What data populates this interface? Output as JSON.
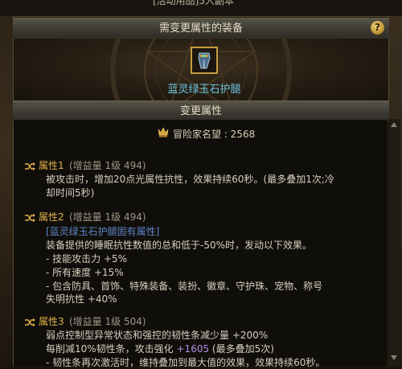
{
  "window": {
    "top_title": "[活动用品]5人副本"
  },
  "equip_section": {
    "title": "需变更属性的装备",
    "item_name": "蓝灵绿玉石护腿",
    "item_icon": "leg-armor-icon"
  },
  "change_section": {
    "title": "变更属性"
  },
  "fame": {
    "label": "冒险家名望 : 2568",
    "icon": "fame-crown-icon"
  },
  "attributes": [
    {
      "header_name": "属性1",
      "header_meta": "(增益量 1级 494)",
      "lines": [
        {
          "text": "被攻击时，增加20点光属性抗性，效果持续60秒。(最多叠加1次;冷"
        },
        {
          "text": "却时间5秒)"
        }
      ]
    },
    {
      "header_name": "属性2",
      "header_meta": "(增益量 1级 494)",
      "lines": [
        {
          "text": "[蓝灵绿玉石护腿固有属性]"
        },
        {
          "text": "装备提供的睡眠抗性数值的总和低于-50%时，发动以下效果。"
        },
        {
          "text": "- 技能攻击力 +5%"
        },
        {
          "text": "- 所有速度 +15%"
        },
        {
          "text": "- 包含防具、首饰、特殊装备、装扮、徽章、守护珠、宠物、称号"
        },
        {
          "text": "失明抗性 +40%"
        }
      ]
    },
    {
      "header_name": "属性3",
      "header_meta": "(增益量 1级 504)",
      "lines": [
        {
          "text": "弱点控制型异常状态和强控的韧性条减少量 +200%"
        },
        {
          "text_a": "每削减10%韧性条，攻击强化 ",
          "text_b": "+1605",
          "text_c": " (最多叠加5次)"
        },
        {
          "text": "- 韧性条再次激活时，维持叠加到最大值的效果，效果持续60秒。"
        }
      ]
    }
  ],
  "colors": {
    "header_gold": "#e3b14a",
    "item_name": "#6fc7e0",
    "highlight": "#b28ce6",
    "unique_tag": "#5e87c8"
  }
}
